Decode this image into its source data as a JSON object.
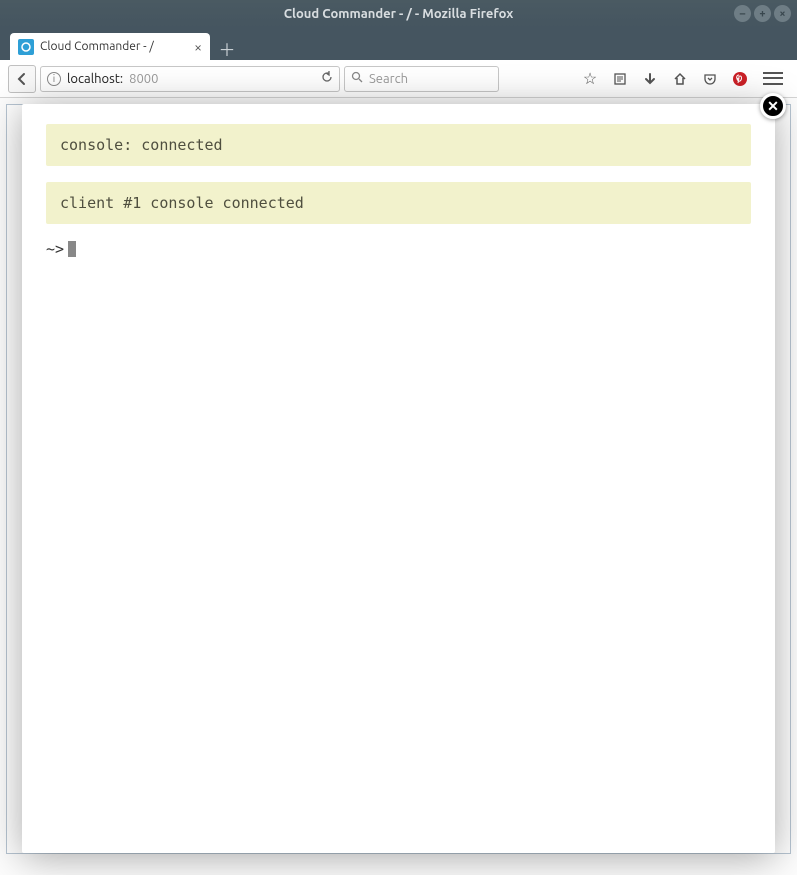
{
  "window": {
    "title": "Cloud Commander - / - Mozilla Firefox"
  },
  "tab": {
    "title": "Cloud Commander - /"
  },
  "urlbar": {
    "domain": "localhost:",
    "port": "8000"
  },
  "search": {
    "placeholder": "Search"
  },
  "console": {
    "messages": [
      "console: connected",
      "client #1 console connected"
    ],
    "prompt": "~>"
  }
}
